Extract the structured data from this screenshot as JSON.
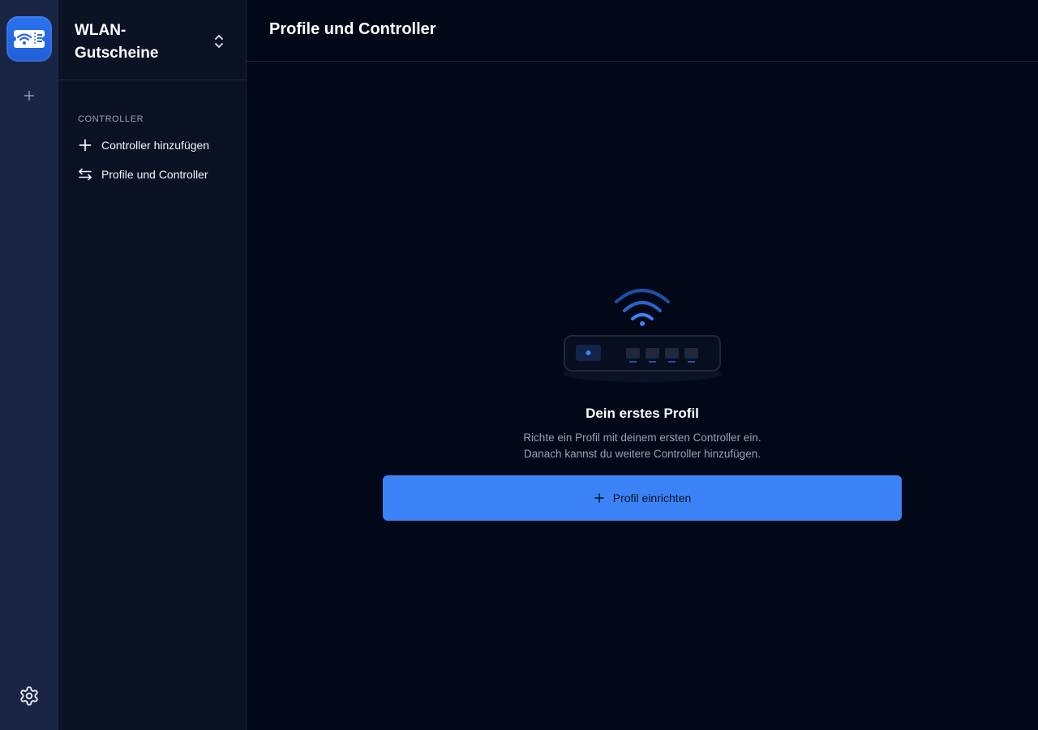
{
  "rail": {
    "app_icon": "wifi-ticket-icon",
    "add_icon": "plus-icon",
    "settings_icon": "gear-icon"
  },
  "sidebar": {
    "workspace_title_line1": "WLAN-",
    "workspace_title_line2": "Gutscheine",
    "section_label": "CONTROLLER",
    "items": [
      {
        "label": "Controller hinzufügen",
        "icon": "plus-icon"
      },
      {
        "label": "Profile und Controller",
        "icon": "arrows-left-right-icon"
      }
    ]
  },
  "main": {
    "title": "Profile und Controller",
    "empty_state": {
      "illustration": "router-wifi-icon",
      "title": "Dein erstes Profil",
      "desc_line1": "Richte ein Profil mit deinem ersten Controller ein.",
      "desc_line2": "Danach kannst du weitere Controller hinzufügen.",
      "button_label": "Profil einrichten"
    }
  },
  "colors": {
    "background": "#020817",
    "rail": "#1a2545",
    "sidebar": "#0b1224",
    "accent": "#3b82f6",
    "border": "#1e293b"
  }
}
